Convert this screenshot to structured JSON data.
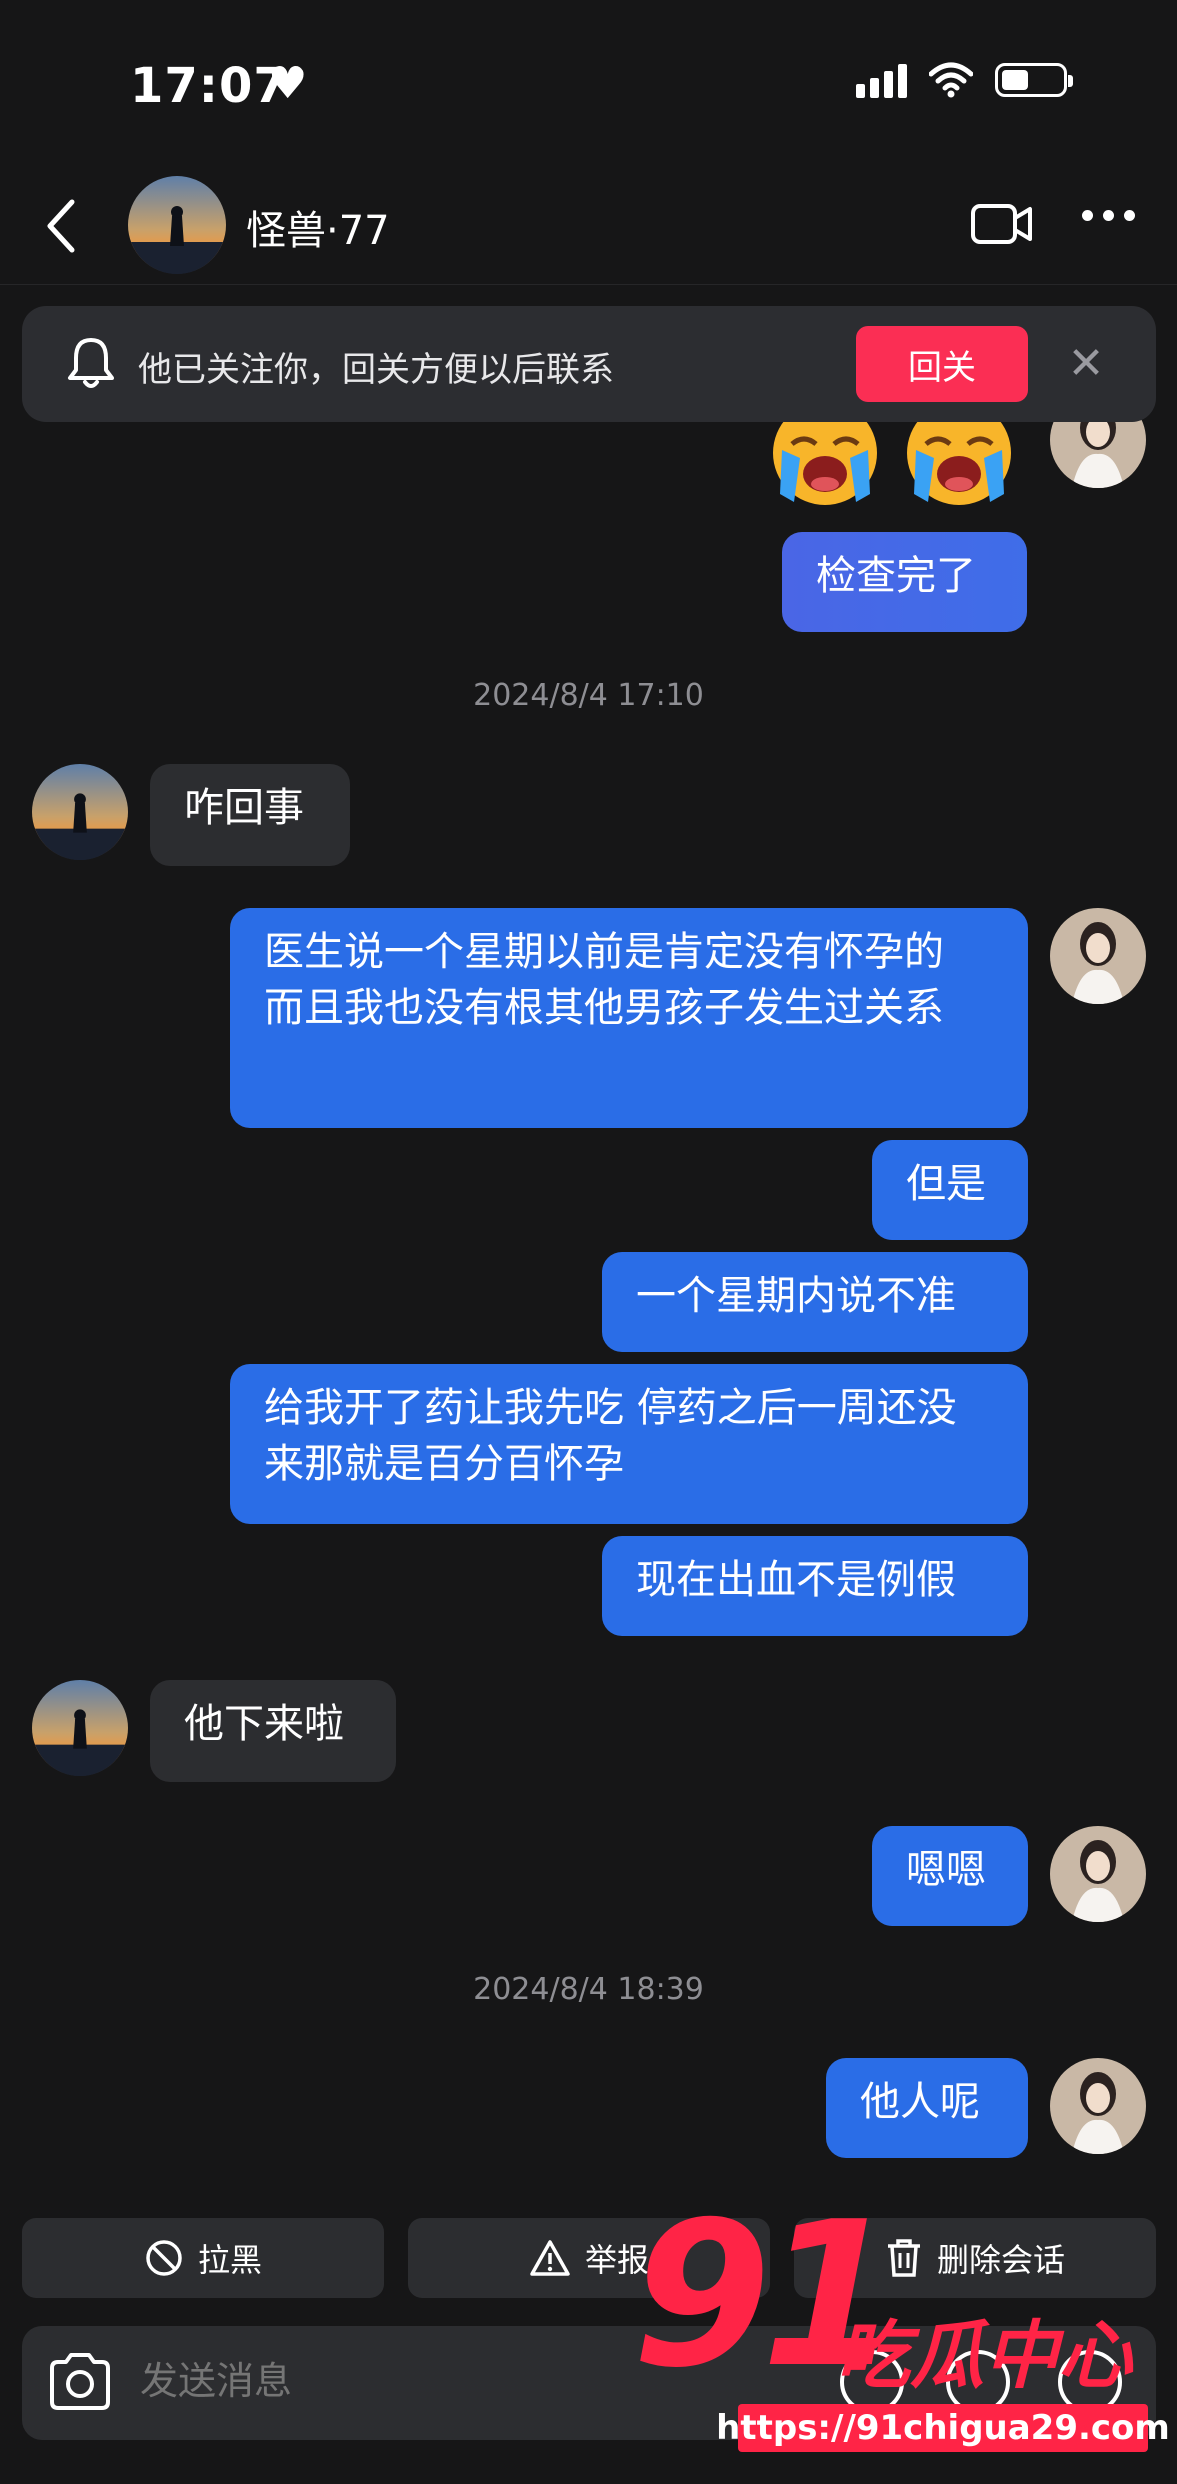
{
  "status_bar": {
    "time": "17:07",
    "heart": "♥",
    "battery_level": 0.45
  },
  "header": {
    "contact_name": "怪兽·77"
  },
  "follow_banner": {
    "text": "他已关注你，回关方便以后联系",
    "button": "回关",
    "close": "✕"
  },
  "messages": {
    "m1": "检查完了",
    "ts1": "2024/8/4 17:10",
    "m2": "咋回事",
    "m3": "医生说一个星期以前是肯定没有怀孕的 而且我也没有根其他男孩子发生过关系",
    "m4": "但是",
    "m5": "一个星期内说不准",
    "m6": "给我开了药让我先吃 停药之后一周还没来那就是百分百怀孕",
    "m7": "现在出血不是例假",
    "m8": "他下来啦",
    "m9": "嗯嗯",
    "ts2": "2024/8/4 18:39",
    "m10": "他人呢"
  },
  "actions": {
    "block": "拉黑",
    "report": "举报",
    "delete": "删除会话"
  },
  "input": {
    "placeholder": "发送消息"
  },
  "watermark": {
    "number": "91",
    "text": "吃瓜中心",
    "url": "https://91chigua29.com"
  },
  "colors": {
    "bubble_right": "#2a6de7",
    "bubble_left": "#2c2d30",
    "accent": "#fb2e54",
    "background": "#161617"
  }
}
